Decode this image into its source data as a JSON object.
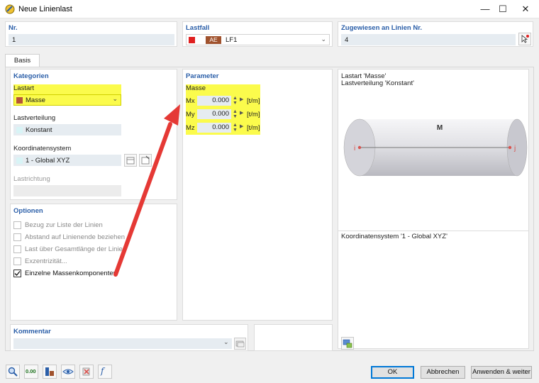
{
  "window": {
    "title": "Neue Linienlast",
    "minimize": "—",
    "maximize": "☐",
    "close": "✕"
  },
  "header": {
    "nr_label": "Nr.",
    "nr_value": "1",
    "lastfall_label": "Lastfall",
    "lastfall_color": "#e02020",
    "lastfall_code": "AE",
    "lastfall_value": "LF1",
    "assigned_label": "Zugewiesen an Linien Nr.",
    "assigned_value": "4"
  },
  "tabs": [
    {
      "label": "Basis"
    }
  ],
  "kategorien": {
    "title": "Kategorien",
    "lastart_label": "Lastart",
    "lastart_value": "Masse",
    "lastart_color": "#b5553a",
    "lastverteilung_label": "Lastverteilung",
    "lastverteilung_value": "Konstant",
    "koord_label": "Koordinatensystem",
    "koord_value": "1 - Global XYZ",
    "lastrichtung_label": "Lastrichtung",
    "lastrichtung_value": ""
  },
  "optionen": {
    "title": "Optionen",
    "items": [
      {
        "label": "Bezug zur Liste der Linien",
        "checked": false
      },
      {
        "label": "Abstand auf Linienende beziehen",
        "checked": false
      },
      {
        "label": "Last über Gesamtlänge der Linie",
        "checked": false
      },
      {
        "label": "Exzentrizität...",
        "checked": false
      },
      {
        "label": "Einzelne Massenkomponenten",
        "checked": true
      }
    ]
  },
  "parameter": {
    "title": "Parameter",
    "group_label": "Masse",
    "rows": [
      {
        "label": "Mx",
        "value": "0.000",
        "unit": "[t/m]"
      },
      {
        "label": "My",
        "value": "0.000",
        "unit": "[t/m]"
      },
      {
        "label": "Mz",
        "value": "0.000",
        "unit": "[t/m]"
      }
    ]
  },
  "preview": {
    "line1": "Lastart 'Masse'",
    "line2": "Lastverteilung 'Konstant'",
    "load_label": "M",
    "start_label": "i",
    "end_label": "j",
    "coord_text": "Koordinatensystem '1 - Global XYZ'"
  },
  "kommentar": {
    "label": "Kommentar",
    "value": ""
  },
  "buttons": {
    "ok": "OK",
    "cancel": "Abbrechen",
    "apply_next": "Anwenden & weiter"
  },
  "bottom_tools": {
    "zero_label": "0.00"
  }
}
